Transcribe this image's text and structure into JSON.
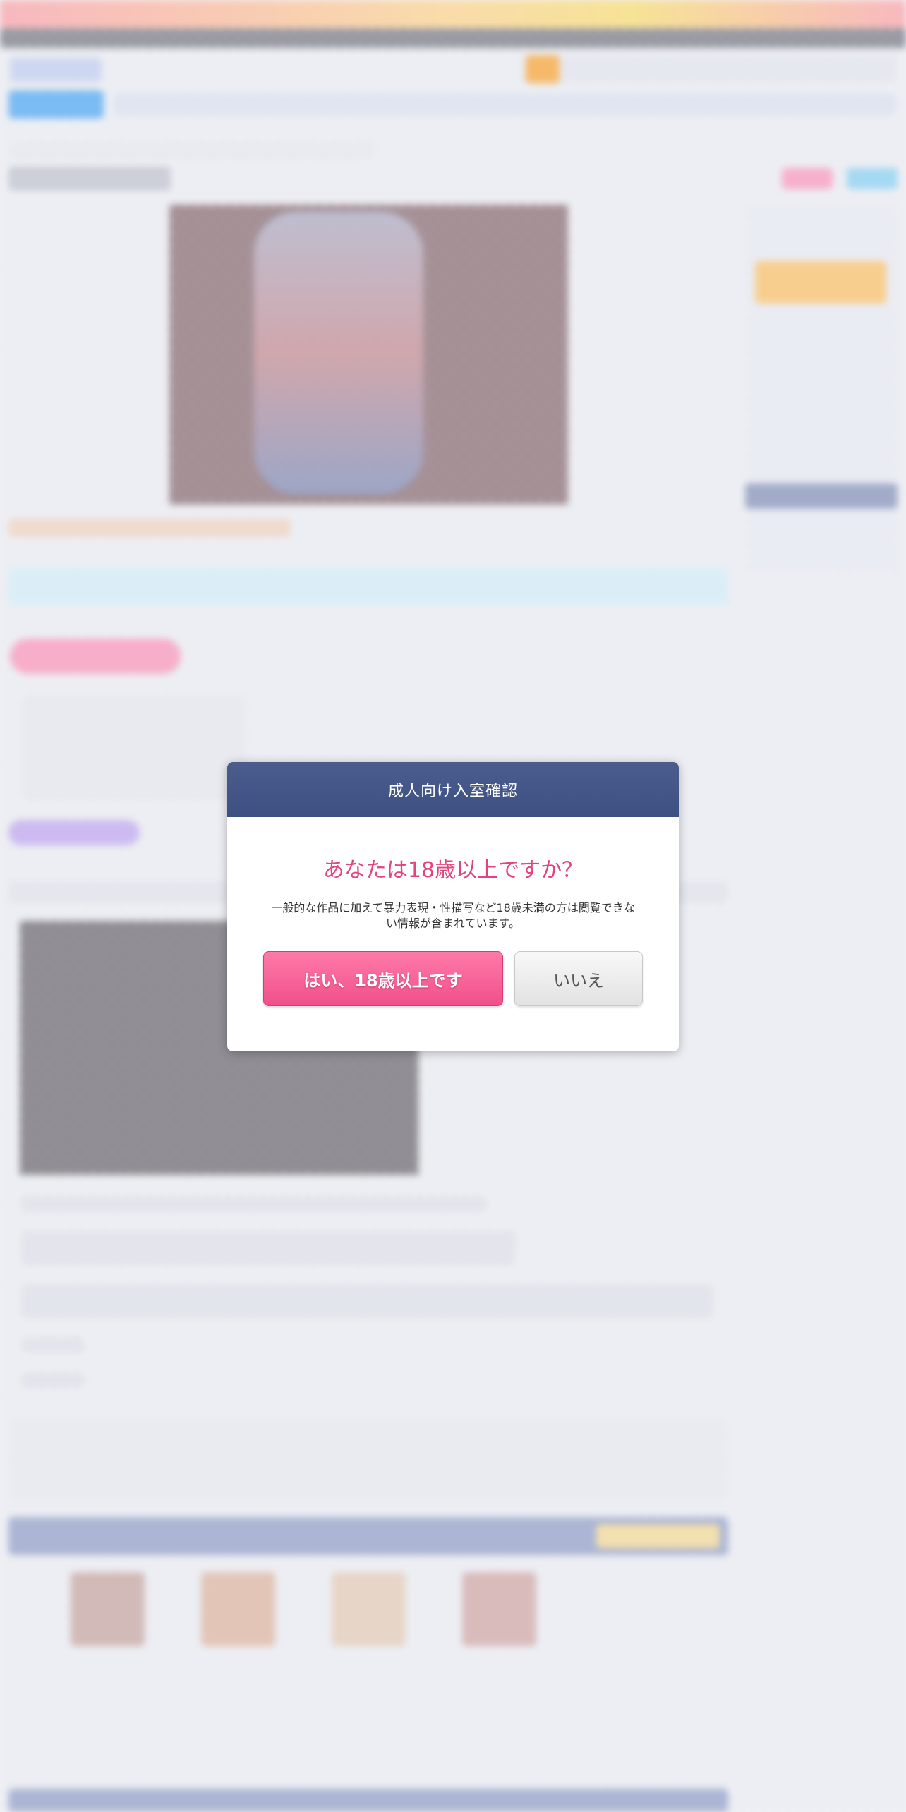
{
  "modal": {
    "title": "成人向け入室確認",
    "question": "あなたは18歳以上ですか？",
    "notice": "一般的な作品に加えて暴力表現・性描写など18歳未満の方は閲覧できない情報が含まれています。",
    "yes_label": "はい、18歳以上です",
    "no_label": "いいえ"
  },
  "colors": {
    "modal_header": "#3f5284",
    "question_text": "#e2457e",
    "yes_button": "#f25a92",
    "no_button": "#e8e8e8"
  }
}
